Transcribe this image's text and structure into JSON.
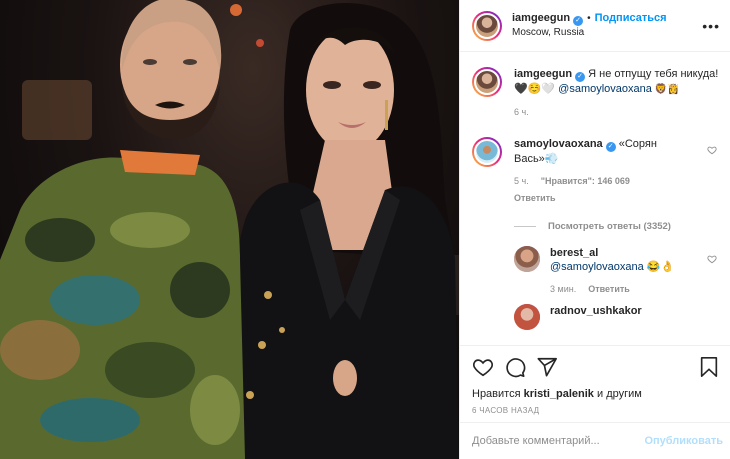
{
  "post": {
    "author": "iamgeegun",
    "follow_label": "Подписаться",
    "dot": "•",
    "location": "Moscow, Russia",
    "more_label": "•••"
  },
  "caption": {
    "author": "iamgeegun",
    "text": " Я не отпущу тебя никуда!🖤☺️🤍 ",
    "mention": "@samoylovaoxana",
    "text2": " 🦁👸",
    "time": "6 ч."
  },
  "comments": [
    {
      "author": "samoylovaoxana",
      "text": " «Сорян Вась»💨",
      "time": "5 ч.",
      "likes": "\"Нравится\": 146 069",
      "reply": "Ответить",
      "view_replies": "Посмотреть ответы (3352)"
    },
    {
      "author": "berest_al",
      "mention": "@samoylovaoxana",
      "text": " 😂👌",
      "time": "3 мин.",
      "reply": "Ответить"
    },
    {
      "author": "radnov_ushkakor"
    }
  ],
  "likes_line": {
    "prefix": "Нравится ",
    "user": "kristi_palenik",
    "suffix": " и другим"
  },
  "timestamp": "6 ЧАСОВ НАЗАД",
  "comment_box": {
    "placeholder": "Добавьте комментарий...",
    "publish_label": "Опубликовать"
  },
  "icons": [
    "heart-icon",
    "comment-icon",
    "share-icon",
    "bookmark-icon",
    "verified-icon",
    "more-icon"
  ],
  "colors": {
    "accent": "#0095f6",
    "publish_disabled": "#b2dffc",
    "meta": "#8e8e8e",
    "verified": "#3897f0"
  }
}
